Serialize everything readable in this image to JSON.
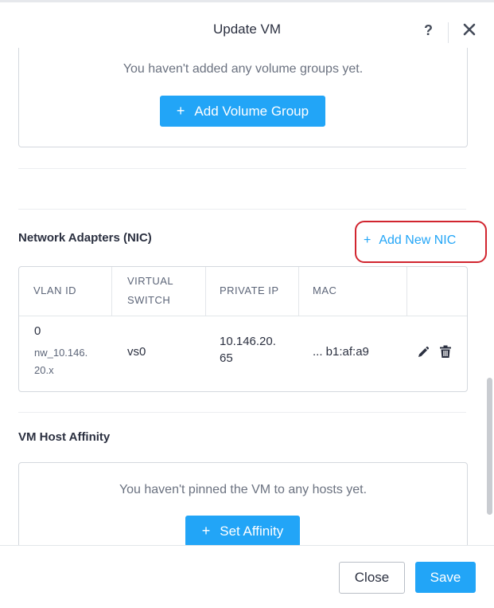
{
  "modal": {
    "title": "Update VM",
    "help_label": "?"
  },
  "volume_groups": {
    "empty_text": "You haven't added any volume groups yet.",
    "add_button": "Add Volume Group"
  },
  "network_adapters": {
    "title": "Network Adapters (NIC)",
    "add_button": "Add New NIC",
    "columns": [
      "VLAN ID",
      "VIRTUAL\nSWITCH",
      "PRIVATE IP",
      "MAC"
    ],
    "rows": [
      {
        "vlan_id": "0",
        "vlan_name": "nw_10.146.\n20.x",
        "virtual_switch": "vs0",
        "private_ip": "10.146.20.\n65",
        "mac": "... b1:af:a9"
      }
    ]
  },
  "host_affinity": {
    "title": "VM Host Affinity",
    "empty_text": "You haven't pinned the VM to any hosts yet.",
    "set_button": "Set Affinity"
  },
  "footer": {
    "close_button": "Close",
    "save_button": "Save"
  },
  "colors": {
    "primary": "#22a5f7",
    "highlight": "#d1252f"
  }
}
